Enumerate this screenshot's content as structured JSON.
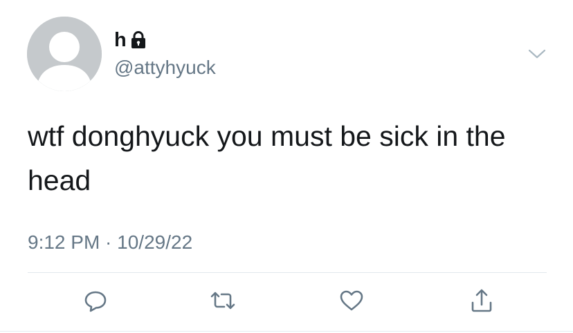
{
  "tweet": {
    "author": {
      "display_name": "h",
      "handle": "@attyhyuck",
      "protected_icon": "lock-icon"
    },
    "text": "wtf donghyuck you must be sick in the head",
    "timestamp": "9:12 PM · 10/29/22",
    "menu_icon": "chevron-down-icon"
  },
  "actions": [
    {
      "name": "reply",
      "icon": "speech-bubble-icon"
    },
    {
      "name": "retweet",
      "icon": "retweet-arrows-icon"
    },
    {
      "name": "like",
      "icon": "heart-icon"
    },
    {
      "name": "share",
      "icon": "share-upload-icon"
    }
  ],
  "colors": {
    "text_primary": "#14171a",
    "text_secondary": "#657786",
    "icon_gray": "#657786",
    "avatar_gray": "#c5c9cc",
    "divider": "#e1e8ed"
  }
}
